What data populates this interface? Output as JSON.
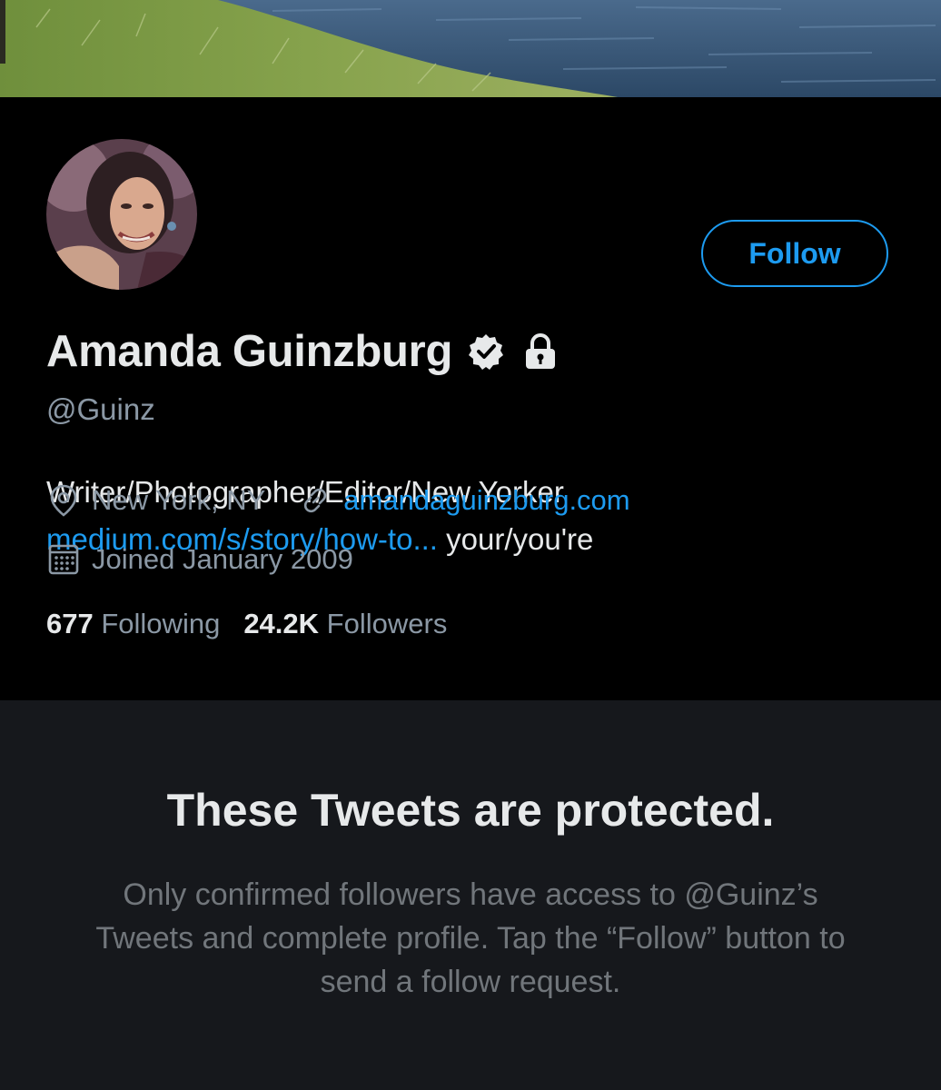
{
  "profile": {
    "display_name": "Amanda Guinzburg",
    "handle": "@Guinz",
    "bio_line1": "Writer/Photographer/Editor/New Yorker",
    "bio_link": "medium.com/s/story/how-to...",
    "bio_suffix": " your/you're",
    "location": "New York, NY",
    "website": "amandaguinzburg.com",
    "joined": "Joined January 2009",
    "following_count": "677",
    "following_label": "Following",
    "followers_count": "24.2K",
    "followers_label": "Followers"
  },
  "actions": {
    "follow_label": "Follow"
  },
  "protected_notice": {
    "title": "These Tweets are protected.",
    "body": "Only confirmed followers have access to @Guinz’s Tweets and complete profile. Tap the “Follow” button to send a follow request."
  },
  "icons": {
    "verified": "verified-badge-icon",
    "protected": "lock-icon",
    "location": "location-pin-icon",
    "website": "link-icon",
    "joined": "calendar-icon"
  },
  "colors": {
    "accent": "#1d9bf0",
    "background": "#000000",
    "notice_background": "#16181c",
    "secondary_text": "#8b98a5"
  }
}
